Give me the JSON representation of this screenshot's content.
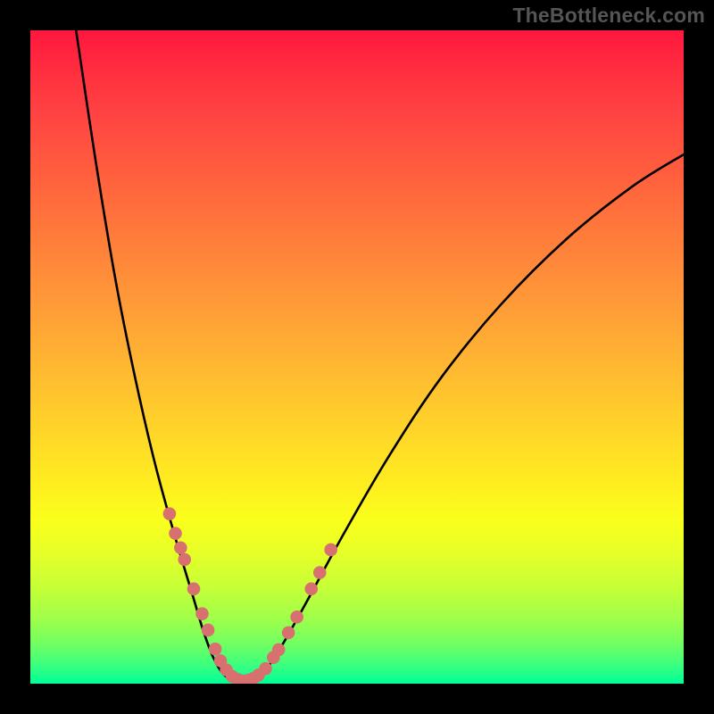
{
  "watermark": "TheBottleneck.com",
  "colors": {
    "page_bg": "#000000",
    "curve_stroke": "#000000",
    "dot_fill": "#d87070",
    "dot_stroke": "#8a3a3a",
    "watermark": "#555555"
  },
  "chart_data": {
    "type": "line",
    "title": "",
    "xlabel": "",
    "ylabel": "",
    "xlim": [
      0,
      100
    ],
    "ylim": [
      0,
      100
    ],
    "axes_visible": false,
    "gradient_background": true,
    "series": [
      {
        "name": "left-branch",
        "x": [
          7,
          10,
          13,
          16,
          19,
          22,
          25,
          26.5,
          28,
          29.5
        ],
        "y": [
          100,
          80,
          62,
          47,
          34,
          23,
          13,
          8,
          4,
          1.5
        ]
      },
      {
        "name": "valley",
        "x": [
          29.5,
          31,
          32.5,
          34,
          35.5
        ],
        "y": [
          1.5,
          0.6,
          0.3,
          0.6,
          1.5
        ]
      },
      {
        "name": "right-branch",
        "x": [
          35.5,
          38,
          42,
          48,
          55,
          63,
          72,
          82,
          92,
          100
        ],
        "y": [
          1.5,
          5,
          12,
          23,
          35,
          47,
          58,
          68,
          76,
          81
        ]
      }
    ],
    "scatter": [
      {
        "name": "left-dots",
        "x": [
          21.3,
          22.2,
          23.0,
          23.6,
          25.0,
          26.3,
          27.2,
          28.3,
          29.1,
          30.0,
          30.9,
          31.8
        ],
        "y": [
          26.0,
          23.0,
          20.8,
          19.0,
          14.5,
          10.7,
          8.2,
          5.3,
          3.5,
          2.1,
          1.1,
          0.6
        ]
      },
      {
        "name": "valley-dots",
        "x": [
          32.5,
          33.3,
          34.1,
          34.9
        ],
        "y": [
          0.4,
          0.5,
          0.8,
          1.3
        ]
      },
      {
        "name": "right-dots",
        "x": [
          36.0,
          37.2,
          38.0,
          39.5,
          40.8,
          43.0,
          44.3,
          46.0
        ],
        "y": [
          2.3,
          4.0,
          5.2,
          7.8,
          10.2,
          14.5,
          17.0,
          20.5
        ]
      }
    ]
  }
}
